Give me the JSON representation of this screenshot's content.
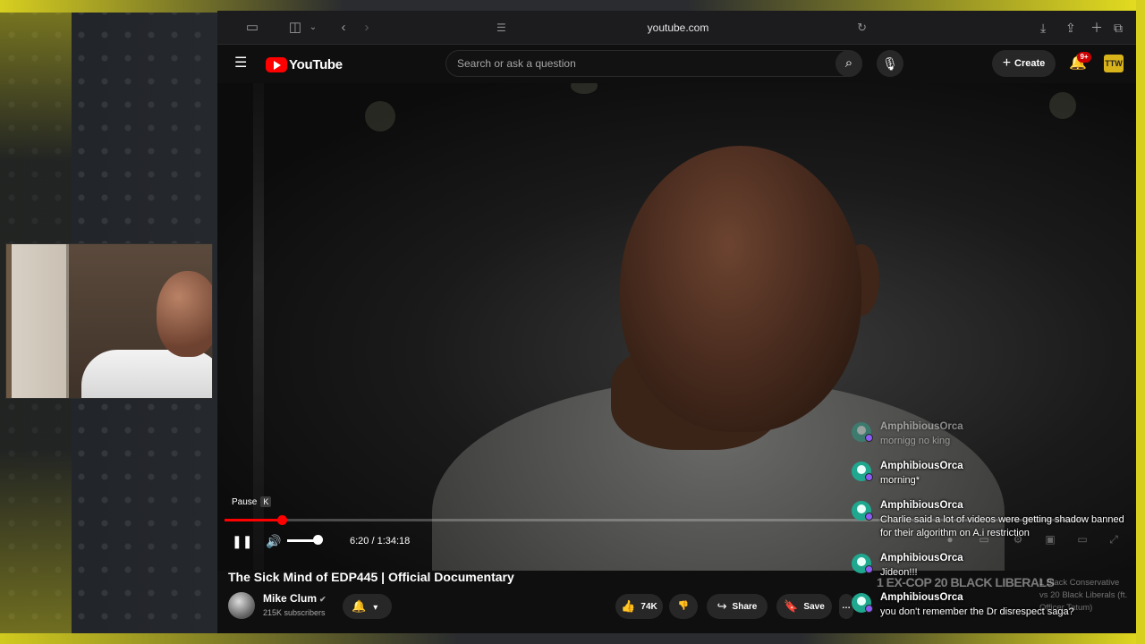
{
  "browser": {
    "url": "youtube.com"
  },
  "youtube": {
    "logo_text": "YouTube",
    "search_placeholder": "Search or ask a question",
    "create_label": "Create",
    "notification_badge": "9+"
  },
  "player": {
    "tooltip_label": "Pause",
    "tooltip_key": "K",
    "current_time": "6:20",
    "duration": "1:34:18",
    "time_display": "6:20 / 1:34:18",
    "progress_fraction": 0.067,
    "volume_fraction": 0.8,
    "progress_color": "#ff0000"
  },
  "video": {
    "title": "The Sick Mind of EDP445 | Official Documentary",
    "channel_name": "Mike Clum",
    "subscribers": "215K subscribers",
    "likes": "74K",
    "share_label": "Share",
    "save_label": "Save"
  },
  "chat": {
    "messages": [
      {
        "user": "AmphibiousOrca",
        "text": "mornigg no king",
        "faded": true
      },
      {
        "user": "AmphibiousOrca",
        "text": "morning*",
        "faded": false
      },
      {
        "user": "AmphibiousOrca",
        "text": "Charlie said a lot of videos were getting shadow banned for their algorithm on A.i restriction",
        "faded": false
      },
      {
        "user": "AmphibiousOrca",
        "text": "Jideon!!!",
        "faded": false
      },
      {
        "user": "AmphibiousOrca",
        "text": "you don't remember the Dr disrespect saga?",
        "faded": false
      }
    ],
    "accent_color": "#1fa88f"
  },
  "overlay": {
    "banner_text": "1 EX-COP 20 BLACK LIBERALS",
    "side_text": "1 Black Conservative vs 20 Black Liberals (ft. Officer Tatum)"
  }
}
